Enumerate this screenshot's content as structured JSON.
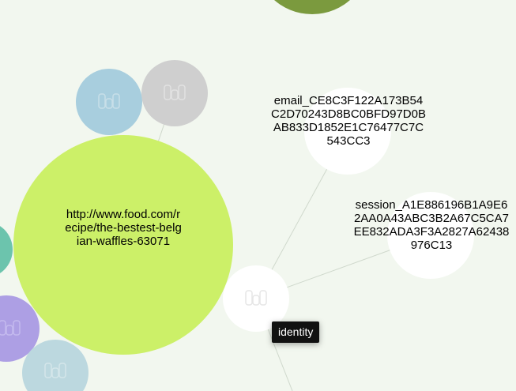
{
  "colors": {
    "background": "#f2f7ef",
    "edge": "#cfd8cc",
    "url_node": "#ccf068",
    "top_node": "#7b9a3e",
    "blue_node": "#a8cede",
    "grey_node": "#cfcfcf",
    "teal_node": "#6cc4ad",
    "purple_node": "#ad9fe4",
    "pale_blue_node": "#bcd8df",
    "white_node": "#ffffff",
    "tooltip_bg": "#111111",
    "tooltip_text": "#ffffff"
  },
  "nodes": {
    "url": {
      "label": "http://www.food.com/recipe/the-bestest-belgian-waffles-63071",
      "icon": "cookie-icon"
    },
    "email": {
      "label": "email_CE8C3F122A173B54C2D70243D8BC0BFD97D0BAB833D1852E1C76477C7C543CC3"
    },
    "session": {
      "label": "session_A1E886196B1A9E62AA0A43ABC3B2A67C5CA7EE832ADA3F3A2827A62438976C13"
    },
    "identity": {
      "icon": "cookie-icon"
    }
  },
  "tooltip": {
    "text": "identity"
  }
}
